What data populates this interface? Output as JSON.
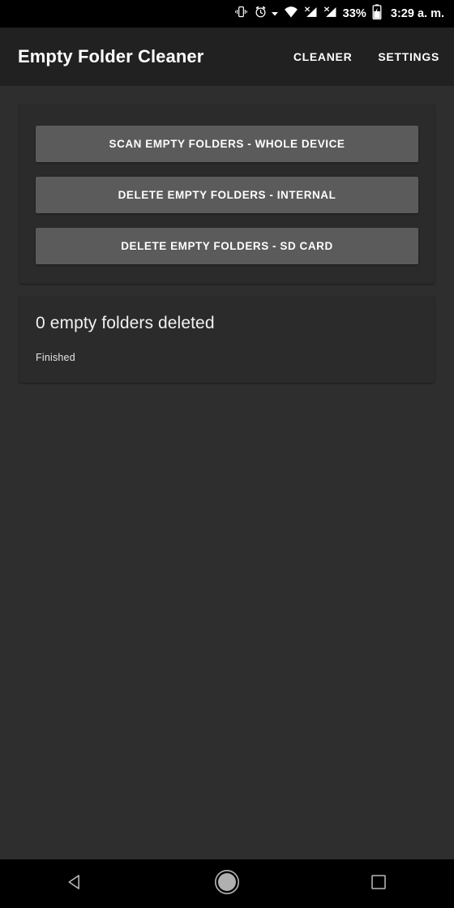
{
  "status_bar": {
    "icons": [
      {
        "name": "vibrate-icon",
        "label": "vibrate"
      },
      {
        "name": "alarm-icon",
        "label": "alarm"
      },
      {
        "name": "dropdown-caret-icon",
        "label": "caret"
      },
      {
        "name": "wifi-icon",
        "label": "wifi"
      },
      {
        "name": "cellular-sim1-no-service-icon",
        "label": "sim1-no-service"
      },
      {
        "name": "cellular-sim2-no-service-icon",
        "label": "sim2-no-service"
      }
    ],
    "battery_percent": "33%",
    "battery_icon": "battery-charging-icon",
    "clock": "3:29 a. m.",
    "background_color": "#000000"
  },
  "app_bar": {
    "title": "Empty Folder Cleaner",
    "background_color": "#212121",
    "actions": [
      {
        "name": "action-cleaner",
        "label": "CLEANER"
      },
      {
        "name": "action-settings",
        "label": "SETTINGS"
      }
    ]
  },
  "main": {
    "background_color": "#2e2e2e",
    "card_color": "#2b2b2b",
    "button_color": "#5b5b5b",
    "buttons": [
      {
        "name": "scan-empty-folders-whole-device-button",
        "label": "SCAN EMPTY FOLDERS - WHOLE DEVICE"
      },
      {
        "name": "delete-empty-folders-internal-button",
        "label": "DELETE EMPTY FOLDERS - INTERNAL"
      },
      {
        "name": "delete-empty-folders-sd-card-button",
        "label": "DELETE EMPTY FOLDERS - SD CARD"
      }
    ],
    "status": {
      "title": "0 empty folders deleted",
      "subtitle": "Finished"
    }
  },
  "nav_bar": {
    "background_color": "#000000",
    "buttons": [
      {
        "name": "nav-back-button",
        "label": "Back"
      },
      {
        "name": "nav-home-button",
        "label": "Home"
      },
      {
        "name": "nav-recents-button",
        "label": "Recents"
      }
    ]
  }
}
